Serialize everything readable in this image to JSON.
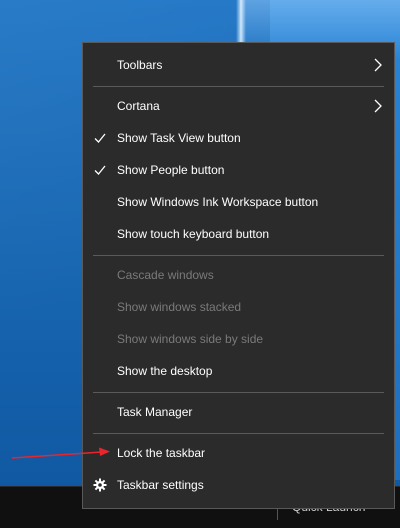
{
  "menu": {
    "toolbars": "Toolbars",
    "cortana": "Cortana",
    "show_task_view": "Show Task View button",
    "show_people": "Show People button",
    "show_ink": "Show Windows Ink Workspace button",
    "show_touch_keyboard": "Show touch keyboard button",
    "cascade": "Cascade windows",
    "stacked": "Show windows stacked",
    "side_by_side": "Show windows side by side",
    "show_desktop": "Show the desktop",
    "task_manager": "Task Manager",
    "lock_taskbar": "Lock the taskbar",
    "taskbar_settings": "Taskbar settings"
  },
  "taskbar": {
    "quick_launch": "Quick Launch"
  },
  "state": {
    "task_view_checked": true,
    "people_checked": true,
    "disabled_items": [
      "Cascade windows",
      "Show windows stacked",
      "Show windows side by side"
    ]
  },
  "icons": {
    "submenu_arrow": "chevron-right-icon",
    "check": "check-icon",
    "settings": "gear-icon",
    "annotation": "red-arrow"
  },
  "colors": {
    "menu_bg": "#2b2b2b",
    "menu_border": "#595959",
    "text": "#ffffff",
    "text_disabled": "#7a7a7a",
    "annotation": "#e8262c"
  }
}
